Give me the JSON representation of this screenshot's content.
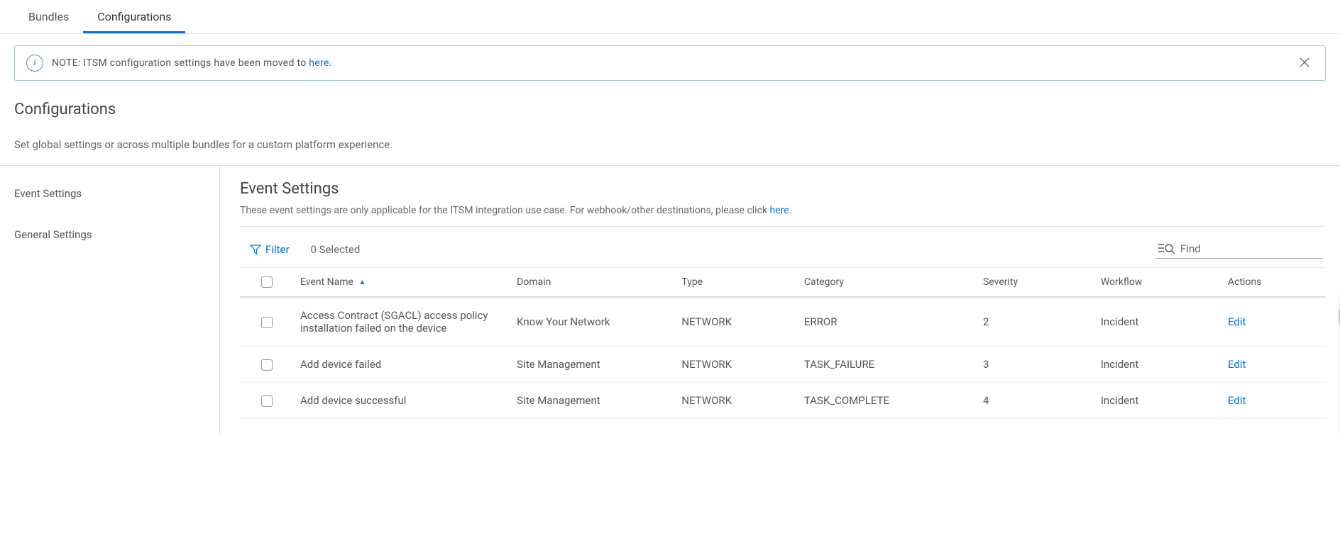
{
  "tabs": {
    "bundles": "Bundles",
    "configurations": "Configurations"
  },
  "banner": {
    "prefix": "NOTE: ITSM configuration settings have been moved to ",
    "link": "here."
  },
  "page": {
    "title": "Configurations",
    "desc": "Set global settings or across multiple bundles for a custom platform experience."
  },
  "sidebar": {
    "items": [
      "Event Settings",
      "General Settings"
    ]
  },
  "content": {
    "title": "Event Settings",
    "desc_prefix": "These event settings are only applicable for the ITSM integration use case. For webhook/other destinations, please click ",
    "desc_link": "here",
    "desc_suffix": "."
  },
  "toolbar": {
    "filter": "Filter",
    "selected_count": "0 Selected",
    "find_placeholder": "Find"
  },
  "table": {
    "headers": {
      "event_name": "Event Name",
      "domain": "Domain",
      "type": "Type",
      "category": "Category",
      "severity": "Severity",
      "workflow": "Workflow",
      "actions": "Actions"
    },
    "edit_label": "Edit",
    "rows": [
      {
        "event_name": "Access Contract (SGACL) access policy installation failed on the device",
        "domain": "Know Your Network",
        "type": "NETWORK",
        "category": "ERROR",
        "severity": "2",
        "workflow": "Incident"
      },
      {
        "event_name": "Add device failed",
        "domain": "Site Management",
        "type": "NETWORK",
        "category": "TASK_FAILURE",
        "severity": "3",
        "workflow": "Incident"
      },
      {
        "event_name": "Add device successful",
        "domain": "Site Management",
        "type": "NETWORK",
        "category": "TASK_COMPLETE",
        "severity": "4",
        "workflow": "Incident"
      }
    ]
  }
}
